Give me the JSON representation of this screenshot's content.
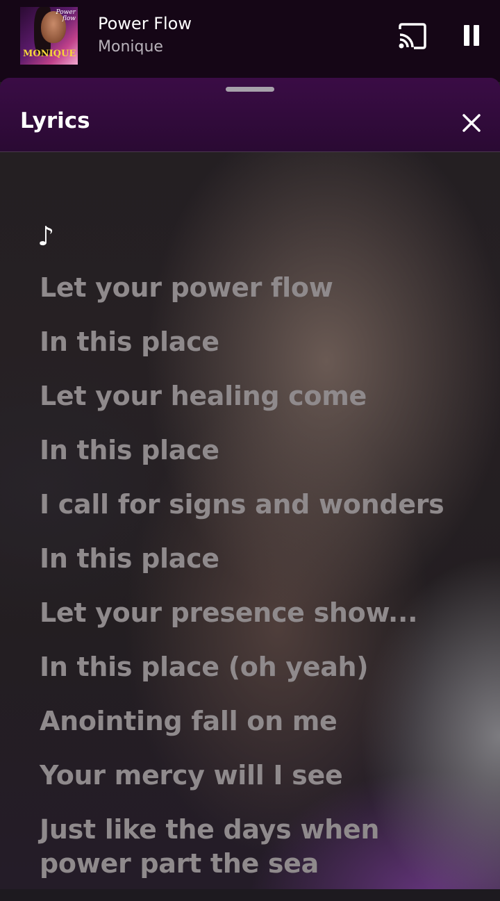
{
  "mini_player": {
    "album_art": {
      "title_text": "Power flow",
      "artist_text": "MONIQUE"
    },
    "track_title": "Power Flow",
    "artist": "Monique",
    "cast_icon": "cast-icon",
    "pause_icon": "pause-icon"
  },
  "lyrics_sheet": {
    "title": "Lyrics",
    "close_icon": "close-icon",
    "note_symbol": "♪",
    "lines": [
      "Let your power flow",
      "In this place",
      "Let your healing come",
      "In this place",
      "I call for signs and wonders",
      "In this place",
      "Let your presence show...",
      "In this place (oh yeah)",
      "Anointing fall on me",
      "Your mercy will I see",
      "Just like the days when power part the sea"
    ]
  },
  "colors": {
    "mini_player_bg": "#150616",
    "sheet_header_bg": "#3a0c45",
    "lyric_text": "#8f8a8c",
    "album_artist_text": "#f6d63a"
  }
}
